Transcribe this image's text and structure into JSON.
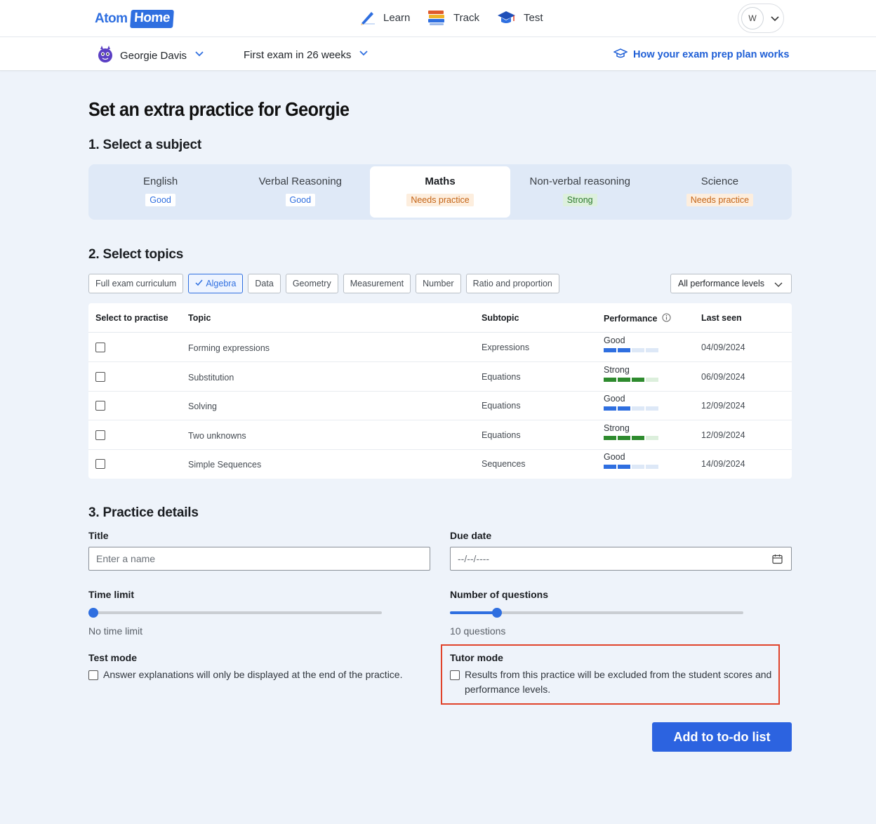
{
  "header": {
    "logo_text": "Atom",
    "logo_badge": "Home",
    "nav": [
      {
        "label": "Learn",
        "icon": "pencil-icon"
      },
      {
        "label": "Track",
        "icon": "books-icon"
      },
      {
        "label": "Test",
        "icon": "graduation-cap-icon"
      }
    ],
    "avatar_initial": "W"
  },
  "subbar": {
    "student_name": "Georgie Davis",
    "exam_text": "First exam in 26 weeks",
    "help_link": "How your exam prep plan works"
  },
  "page_title": "Set an extra practice for Georgie",
  "section1": {
    "heading": "1. Select a subject",
    "subjects": [
      {
        "name": "English",
        "level": "Good"
      },
      {
        "name": "Verbal Reasoning",
        "level": "Good"
      },
      {
        "name": "Maths",
        "level": "Needs practice",
        "selected": true
      },
      {
        "name": "Non-verbal reasoning",
        "level": "Strong"
      },
      {
        "name": "Science",
        "level": "Needs practice"
      }
    ]
  },
  "section2": {
    "heading": "2. Select topics",
    "chips": [
      "Full exam curriculum",
      "Algebra",
      "Data",
      "Geometry",
      "Measurement",
      "Number",
      "Ratio and proportion"
    ],
    "selected_chip": "Algebra",
    "performance_filter": "All performance levels",
    "table": {
      "headers": {
        "select": "Select to practise",
        "topic": "Topic",
        "subtopic": "Subtopic",
        "performance": "Performance",
        "last_seen": "Last seen"
      },
      "rows": [
        {
          "topic": "Forming expressions",
          "subtopic": "Expressions",
          "performance": "Good",
          "level": 2,
          "last_seen": "04/09/2024"
        },
        {
          "topic": "Substitution",
          "subtopic": "Equations",
          "performance": "Strong",
          "level": 3,
          "last_seen": "06/09/2024"
        },
        {
          "topic": "Solving",
          "subtopic": "Equations",
          "performance": "Good",
          "level": 2,
          "last_seen": "12/09/2024"
        },
        {
          "topic": "Two unknowns",
          "subtopic": "Equations",
          "performance": "Strong",
          "level": 3,
          "last_seen": "12/09/2024"
        },
        {
          "topic": "Simple Sequences",
          "subtopic": "Sequences",
          "performance": "Good",
          "level": 2,
          "last_seen": "14/09/2024"
        }
      ]
    }
  },
  "section3": {
    "heading": "3. Practice details",
    "title_label": "Title",
    "title_placeholder": "Enter a name",
    "due_label": "Due date",
    "due_placeholder": "--/--/----",
    "time_label": "Time limit",
    "time_value_text": "No time limit",
    "time_fraction": 0,
    "questions_label": "Number of questions",
    "questions_value_text": "10 questions",
    "questions_fraction": 0.16,
    "test_mode_label": "Test mode",
    "test_mode_text": "Answer explanations will only be displayed at the end of the practice.",
    "tutor_mode_label": "Tutor mode",
    "tutor_mode_text": "Results from this practice will be excluded from the student scores and performance levels.",
    "submit_label": "Add to to-do list"
  },
  "colors": {
    "accent": "#2c63e0",
    "good_bar": "#2f6fe0",
    "strong_bar": "#2e8b2e",
    "highlight": "#e0432b"
  }
}
